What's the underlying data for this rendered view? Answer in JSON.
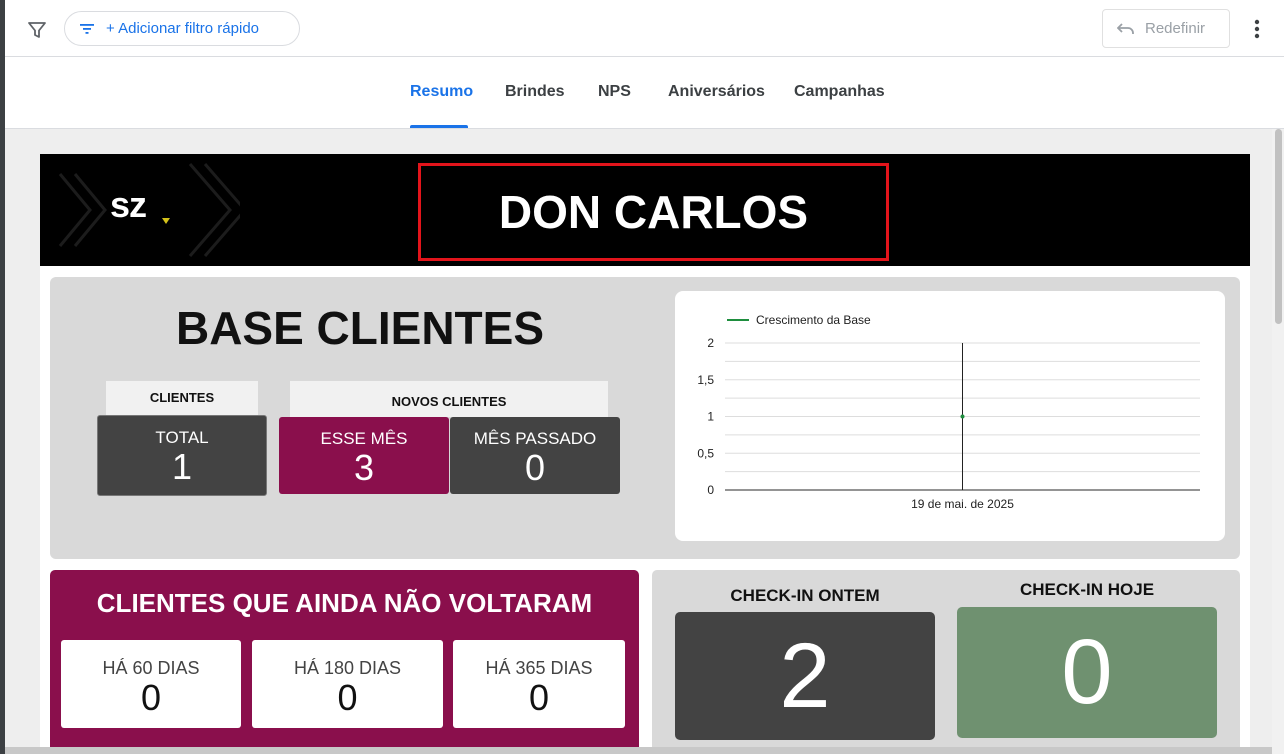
{
  "toolbar": {
    "quick_filter_label": "+ Adicionar filtro rápido",
    "reset_label": "Redefinir",
    "filter_icon": "filter-funnel-icon",
    "more_icon": "more-vert-icon"
  },
  "tabs": [
    {
      "label": "Resumo",
      "active": true
    },
    {
      "label": "Brindes",
      "active": false
    },
    {
      "label": "NPS",
      "active": false
    },
    {
      "label": "Aniversários",
      "active": false
    },
    {
      "label": "Campanhas",
      "active": false
    }
  ],
  "banner": {
    "logo_text": "sz",
    "title": "DON CARLOS"
  },
  "base": {
    "title": "BASE CLIENTES",
    "clientes_label": "CLIENTES",
    "novos_label": "NOVOS CLIENTES",
    "total_label": "TOTAL",
    "total_value": "1",
    "esse_mes_label": "ESSE MÊS",
    "esse_mes_value": "3",
    "mes_passado_label": "MÊS PASSADO",
    "mes_passado_value": "0"
  },
  "chart_data": {
    "type": "line",
    "legend": "Crescimento da Base",
    "legend_position": "top-left",
    "x": [
      "19 de mai. de 2025"
    ],
    "series": [
      {
        "name": "Crescimento da Base",
        "values": [
          1
        ]
      }
    ],
    "y_ticks": [
      "2",
      "1,5",
      "1",
      "0,5",
      "0"
    ],
    "ylim": [
      0,
      2
    ],
    "grid": true,
    "color": "#1e8e3e"
  },
  "not_returned": {
    "title": "CLIENTES QUE AINDA NÃO VOLTARAM",
    "cards": [
      {
        "label": "HÁ 60 DIAS",
        "value": "0"
      },
      {
        "label": "HÁ 180 DIAS",
        "value": "0"
      },
      {
        "label": "HÁ 365 DIAS",
        "value": "0"
      }
    ]
  },
  "checkin": {
    "ontem_label": "CHECK-IN ONTEM",
    "ontem_value": "2",
    "hoje_label": "CHECK-IN HOJE",
    "hoje_value": "0"
  },
  "colors": {
    "accent": "#1a73e8",
    "magenta": "#8a0f4c",
    "dark_kpi": "#434343",
    "green_kpi": "#6f9170",
    "title_border": "#e3141b"
  }
}
